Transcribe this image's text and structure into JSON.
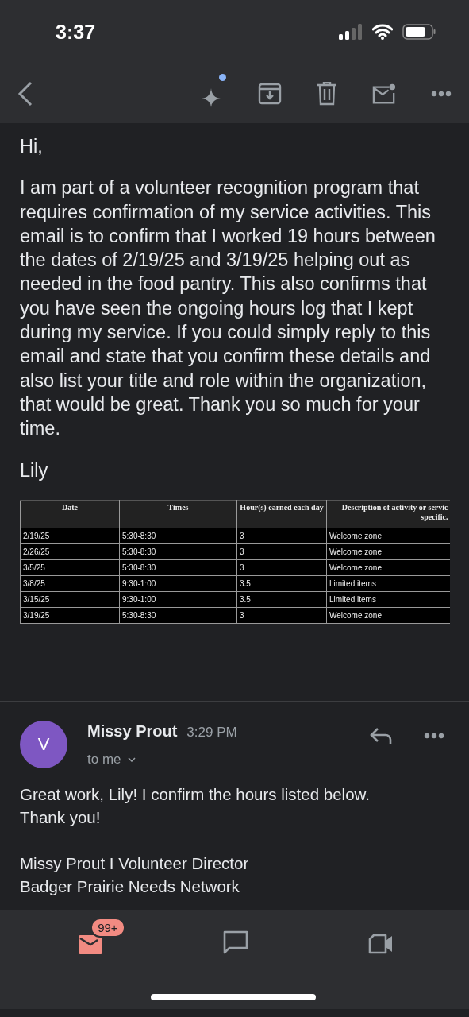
{
  "status_bar": {
    "time": "3:37"
  },
  "toolbar": {
    "assistant_badge": true
  },
  "message": {
    "greeting": "Hi,",
    "body": "I am part of a volunteer recognition program that requires confirmation of my service activities. This email is to confirm that I worked 19 hours between the dates of 2/19/25 and 3/19/25 helping out as needed in the food pantry. This also confirms that you have seen the ongoing hours log that I kept during my service. If you could simply reply to this email and state that you confirm these details and also list your title and role within the organization, that would be great. Thank you so much for your time.",
    "signature": "Lily",
    "table": {
      "columns": [
        "Date",
        "Times",
        "Hour(s) earned each day",
        "Description of activity or servic\nspecific."
      ],
      "rows": [
        [
          "2/19/25",
          "5:30-8:30",
          "3",
          "Welcome zone"
        ],
        [
          "2/26/25",
          "5:30-8:30",
          "3",
          "Welcome zone"
        ],
        [
          "3/5/25",
          "5:30-8:30",
          "3",
          "Welcome zone"
        ],
        [
          "3/8/25",
          "9:30-1:00",
          "3.5",
          "Limited items"
        ],
        [
          "3/15/25",
          "9:30-1:00",
          "3.5",
          "Limited items"
        ],
        [
          "3/19/25",
          "5:30-8:30",
          "3",
          "Welcome zone"
        ]
      ]
    }
  },
  "reply": {
    "avatar": "V",
    "sender": "Missy Prout",
    "time": "3:29 PM",
    "recipient": "to me",
    "body": [
      "Great work, Lily! I confirm the hours listed below.",
      "Thank you!"
    ],
    "signature": [
      "Missy Prout I Volunteer Director",
      "Badger Prairie Needs Network"
    ]
  },
  "bottom_nav": [
    {
      "kind": "mail",
      "badge": "99+",
      "selected": true
    },
    {
      "kind": "chat",
      "selected": false
    },
    {
      "kind": "meet",
      "selected": false
    }
  ]
}
